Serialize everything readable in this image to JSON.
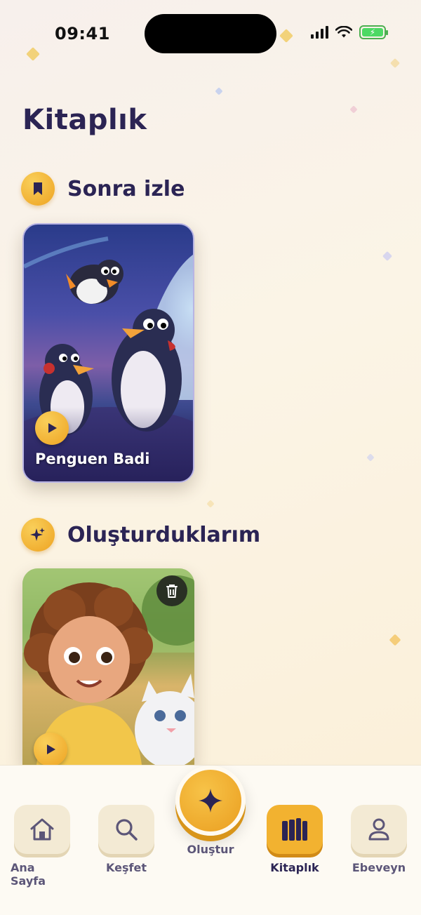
{
  "status_bar": {
    "time": "09:41"
  },
  "page": {
    "title": "Kitaplık"
  },
  "watch_later": {
    "title": "Sonra izle",
    "items": [
      {
        "title": "Penguen Badi"
      }
    ]
  },
  "created": {
    "title": "Oluşturduklarım"
  },
  "tab_bar": {
    "tabs": [
      {
        "label": "Ana Sayfa",
        "icon": "home-icon"
      },
      {
        "label": "Keşfet",
        "icon": "search-icon"
      },
      {
        "label": "Oluştur",
        "icon": "sparkle-icon"
      },
      {
        "label": "Kitaplık",
        "icon": "books-icon",
        "active": true
      },
      {
        "label": "Ebeveyn",
        "icon": "user-icon"
      }
    ]
  },
  "colors": {
    "accent": "#f2b230",
    "title": "#2b2454",
    "label": "#5c5678"
  }
}
